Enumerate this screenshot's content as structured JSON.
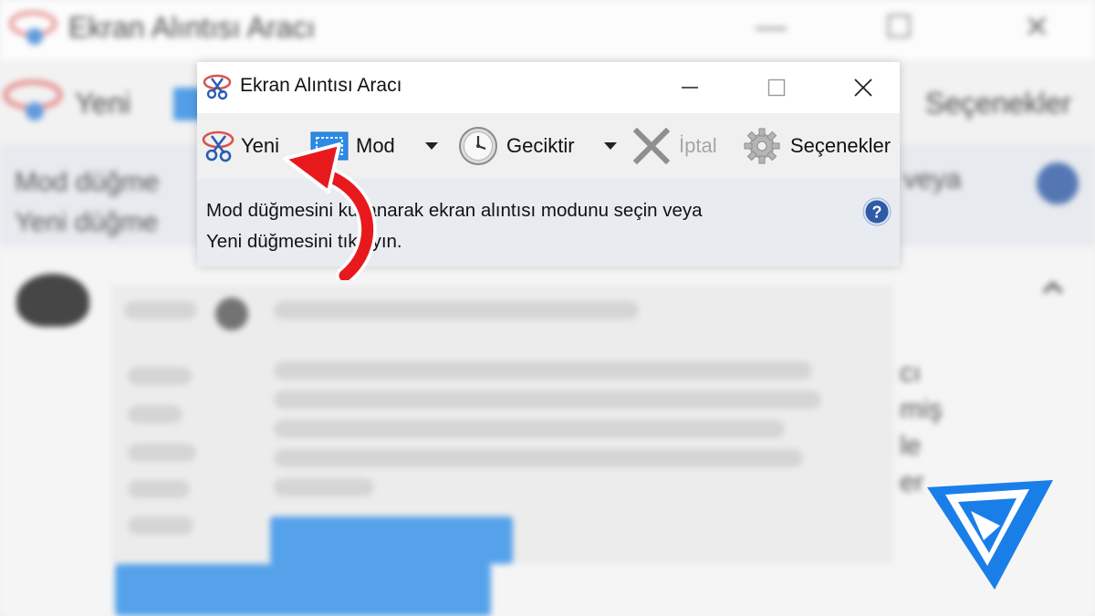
{
  "background_window": {
    "title": "Ekran Alıntısı Aracı",
    "toolbar": {
      "new_label": "Yeni",
      "options_label": "Seçenekler"
    },
    "info_line1": "Mod düğme",
    "info_line1_right": "veya",
    "info_line2": "Yeni düğme",
    "right_fragments": [
      "cı",
      "miş",
      "le",
      "er"
    ]
  },
  "window": {
    "title": "Ekran Alıntısı Aracı",
    "app_icon": "scissors-icon",
    "controls": {
      "minimize": "—",
      "maximize": "☐",
      "close": "✕"
    }
  },
  "toolbar": {
    "new_label": "Yeni",
    "mode_label": "Mod",
    "delay_label": "Geciktir",
    "cancel_label": "İptal",
    "options_label": "Seçenekler",
    "icons": {
      "new": "scissors-icon",
      "mode": "rectangle-mode-icon",
      "delay": "clock-icon",
      "cancel": "x-cancel-icon",
      "options": "gear-icon",
      "dropdown": "triangle-down-icon"
    }
  },
  "info": {
    "line1": "Mod düğmesini kullanarak ekran alıntısı modunu seçin veya",
    "line2": "Yeni düğmesini tıklayın.",
    "help_icon": "help-icon"
  },
  "colors": {
    "accent_blue": "#2d8ae6",
    "help_blue": "#2e5aa6",
    "arrow_red": "#e8191d",
    "brand_blue": "#1a7ee8"
  }
}
